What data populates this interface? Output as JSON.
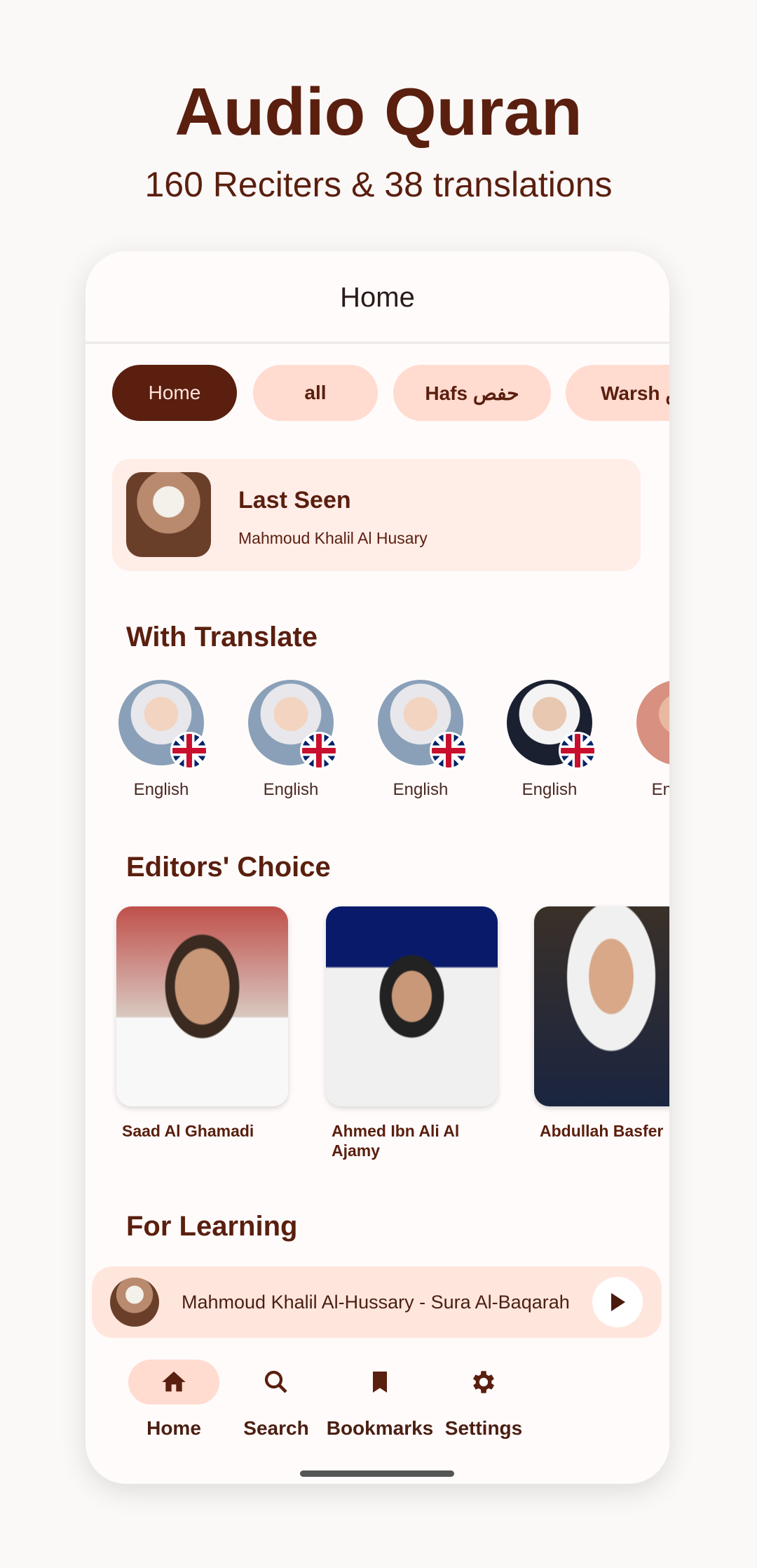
{
  "promo": {
    "title": "Audio Quran",
    "subtitle": "160 Reciters & 38 translations"
  },
  "header": {
    "title": "Home"
  },
  "chips": [
    {
      "label": "Home",
      "selected": true
    },
    {
      "label": "all"
    },
    {
      "label": "Hafs حفص"
    },
    {
      "label": "Warsh ورش"
    }
  ],
  "last_seen": {
    "title": "Last Seen",
    "reciter": "Mahmoud Khalil Al Husary"
  },
  "sections": {
    "translate": "With Translate",
    "editors": "Editors' Choice",
    "learning": "For Learning"
  },
  "translations": [
    {
      "label": "English"
    },
    {
      "label": "English"
    },
    {
      "label": "English"
    },
    {
      "label": "English"
    },
    {
      "label": "English"
    }
  ],
  "editors_choice": [
    {
      "name": "Saad Al Ghamadi"
    },
    {
      "name": "Ahmed Ibn Ali Al Ajamy"
    },
    {
      "name": "Abdullah Basfer"
    }
  ],
  "player": {
    "now_playing": "Mahmoud Khalil Al-Hussary - Sura Al-Baqarah",
    "icon": "play-icon"
  },
  "nav": [
    {
      "label": "Home",
      "icon": "home-icon",
      "active": true
    },
    {
      "label": "Search",
      "icon": "search-icon"
    },
    {
      "label": "Bookmarks",
      "icon": "bookmark-icon"
    },
    {
      "label": "Settings",
      "icon": "gear-icon"
    }
  ],
  "colors": {
    "primary": "#5a1f0e",
    "chip": "#ffdbd0",
    "card": "#ffede8"
  }
}
